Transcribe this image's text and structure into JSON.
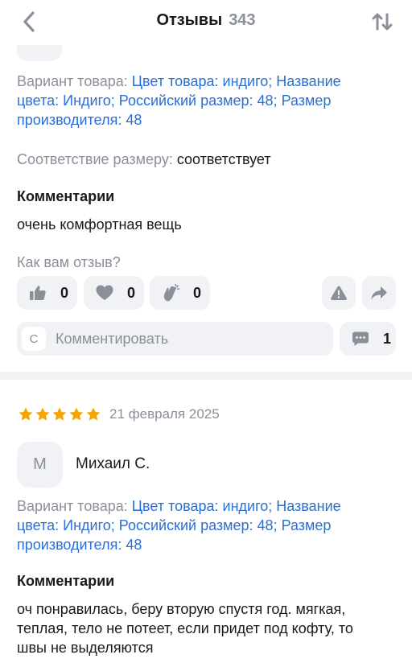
{
  "header": {
    "title": "Отзывы",
    "count": "343"
  },
  "review1": {
    "variant_label": "Вариант товара: ",
    "variant_value_line1": "Цвет товара: индиго; Название",
    "variant_value_line2": "цвета: Индиго; Российский размер: 48; Размер",
    "variant_value_line3": "производителя: 48",
    "fit_label": "Соответствие размеру: ",
    "fit_value": "соответствует",
    "comments_heading": "Комментарии",
    "comment_text": "очень комфортная вещь",
    "rate_question": "Как вам отзыв?",
    "likes": "0",
    "hearts": "0",
    "claps": "0",
    "comment_avatar_letter": "С",
    "comment_placeholder": "Комментировать",
    "comments_count": "1"
  },
  "review2": {
    "rating": 5,
    "date": "21 февраля 2025",
    "avatar_letter": "М",
    "author": "Михаил С.",
    "variant_label": "Вариант товара: ",
    "variant_value_line1": "Цвет товара: индиго; Название",
    "variant_value_line2": "цвета: Индиго; Российский размер: 48; Размер",
    "variant_value_line3": "производителя: 48",
    "comments_heading": "Комментарии",
    "comment_line1": "оч понравилась, беру вторую спустя год. мягкая,",
    "comment_line2": "теплая, тело не потеет, если придет под кофту, то",
    "comment_line3": "швы не выделяются"
  },
  "colors": {
    "accent_blue": "#2a6fd6",
    "star": "#f7a400",
    "muted": "#8a8f99",
    "pill_bg": "#f1f2f6"
  },
  "icons": [
    "chevron-left-icon",
    "sort-arrows-icon",
    "thumb-up-icon",
    "heart-icon",
    "clap-icon",
    "warning-icon",
    "share-icon",
    "comment-bubble-icon",
    "star-icon"
  ]
}
